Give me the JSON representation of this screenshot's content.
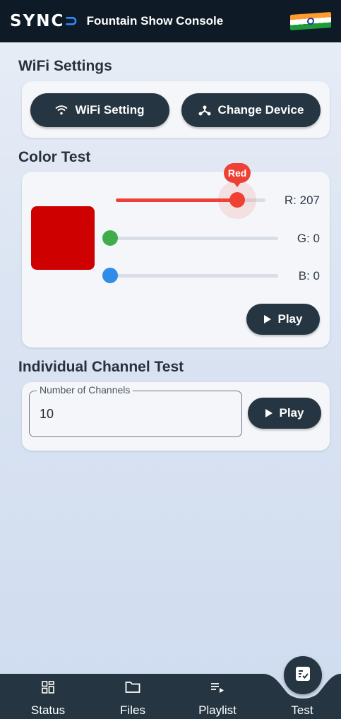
{
  "app_bar": {
    "brand_main": "SYNC",
    "brand_accent": "⊃",
    "title": "Fountain Show Console"
  },
  "wifi": {
    "title": "WiFi Settings",
    "wifi_button": "WiFi Setting",
    "device_button": "Change Device"
  },
  "color_test": {
    "title": "Color Test",
    "swatch_color": "#cf0000",
    "red": {
      "tooltip": "Red",
      "label": "R: 207",
      "value": 207,
      "max": 255,
      "color": "#ef4035"
    },
    "green": {
      "label": "G: 0",
      "value": 0,
      "max": 255,
      "color": "#3fae4a"
    },
    "blue": {
      "label": "B: 0",
      "value": 0,
      "max": 255,
      "color": "#2f8de8"
    },
    "play_button": "Play"
  },
  "channel_test": {
    "title": "Individual Channel Test",
    "field_label": "Number of Channels",
    "field_value": "10",
    "play_button": "Play"
  },
  "bottom_nav": {
    "items": [
      {
        "label": "Status",
        "icon": "dashboard-icon"
      },
      {
        "label": "Files",
        "icon": "folder-icon"
      },
      {
        "label": "Playlist",
        "icon": "playlist-icon"
      },
      {
        "label": "Test",
        "icon": "checklist-icon",
        "active": true
      }
    ],
    "bg_color": "#253541"
  }
}
